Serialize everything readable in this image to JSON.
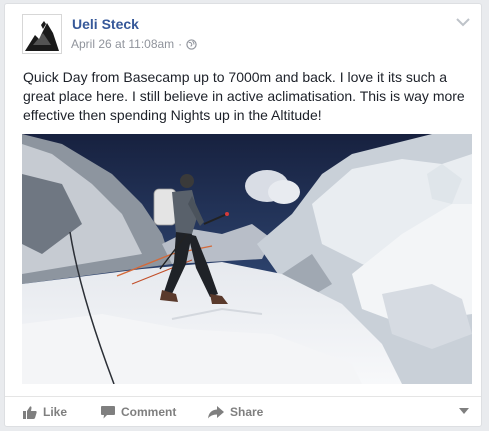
{
  "post": {
    "author": "Ueli Steck",
    "timestamp": "April 26 at 11:08am",
    "separator": "·",
    "audience_icon": "globe-icon",
    "text": "Quick Day from Basecamp up to 7000m and back. I love it its such a great place here. I still believe in active aclimatisation. This is way more effective then spending Nights up in the Altitude!",
    "menu_icon": "chevron-down-icon"
  },
  "actions": {
    "like": {
      "label": "Like",
      "icon": "thumbs-up-icon"
    },
    "comment": {
      "label": "Comment",
      "icon": "comment-icon"
    },
    "share": {
      "label": "Share",
      "icon": "share-arrow-icon"
    },
    "more_icon": "caret-down-icon"
  },
  "colors": {
    "author_link": "#365899",
    "meta_gray": "#90949c",
    "text": "#1d2129",
    "action_gray": "#7f7f7f"
  }
}
